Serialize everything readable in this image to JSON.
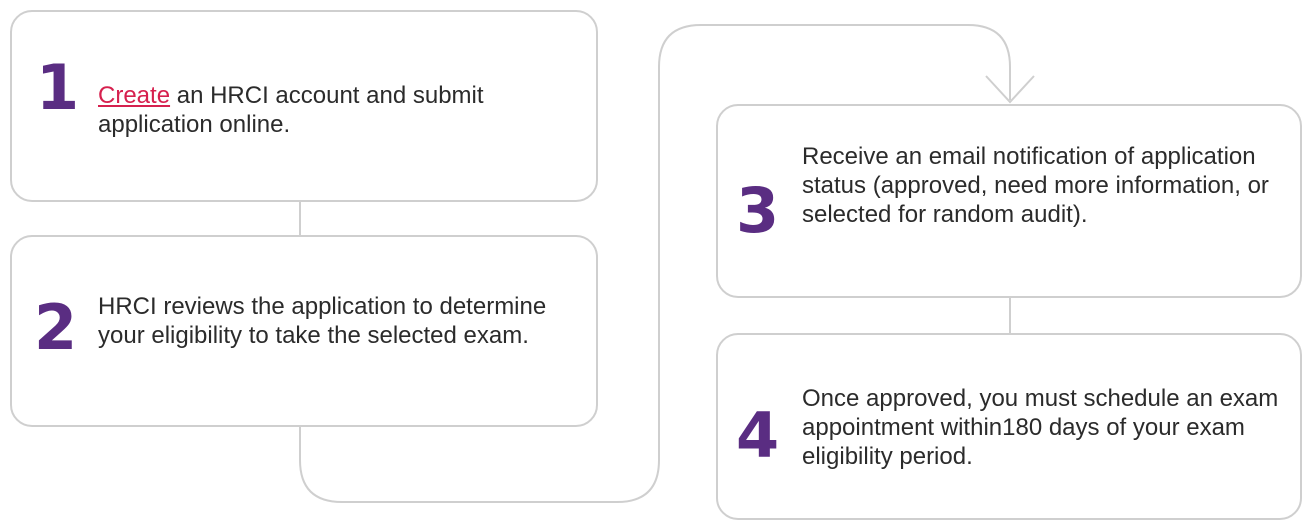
{
  "colors": {
    "number": "#5a2d82",
    "link": "#d6204e",
    "border": "#cfcfcf",
    "text": "#2b2b2b"
  },
  "steps": [
    {
      "number": "1",
      "link_text": "Create",
      "text": " an HRCI account and submit application online."
    },
    {
      "number": "2",
      "text": "HRCI reviews the application to determine your eligibility to take the selected exam."
    },
    {
      "number": "3",
      "text": "Receive an email notification of application status (approved, need more information, or selected for random audit)."
    },
    {
      "number": "4",
      "text": "Once approved, you must schedule an exam appointment within180 days of your exam eligibility period."
    }
  ]
}
